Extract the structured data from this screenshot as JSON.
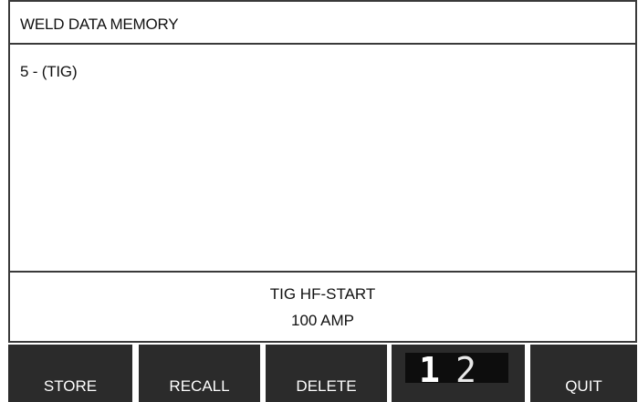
{
  "header": {
    "title": "WELD DATA MEMORY"
  },
  "memory_list": {
    "items": [
      {
        "label": "5 - (TIG)"
      }
    ]
  },
  "info": {
    "line1": "TIG HF-START",
    "line2": "100 AMP"
  },
  "softkeys": {
    "store": "STORE",
    "recall": "RECALL",
    "delete": "DELETE",
    "counter_digit_1": "1",
    "counter_digit_2": "2",
    "quit": "QUIT"
  },
  "colors": {
    "softkey_background": "#2b2b2b",
    "counter_background": "#0d0d0d",
    "border": "#3a3a3a",
    "text": "#111111"
  }
}
